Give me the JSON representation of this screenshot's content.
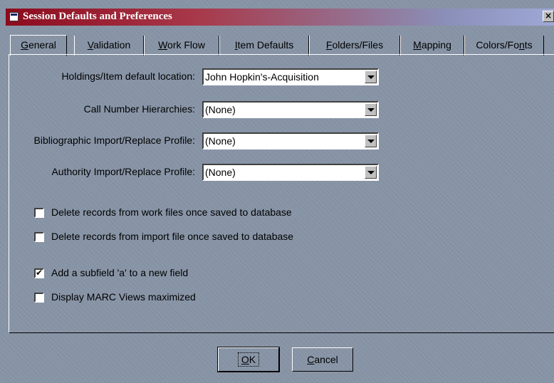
{
  "window": {
    "title": "Session Defaults and Preferences",
    "close_glyph": "×"
  },
  "tabs": [
    {
      "pre": "",
      "key": "G",
      "post": "eneral",
      "active": true
    },
    {
      "pre": "",
      "key": "V",
      "post": "alidation",
      "active": false
    },
    {
      "pre": "",
      "key": "W",
      "post": "ork Flow",
      "active": false
    },
    {
      "pre": "",
      "key": "I",
      "post": "tem Defaults",
      "active": false
    },
    {
      "pre": "",
      "key": "F",
      "post": "olders/Files",
      "active": false
    },
    {
      "pre": "",
      "key": "M",
      "post": "apping",
      "active": false
    },
    {
      "pre": "Colors/Fo",
      "key": "n",
      "post": "ts",
      "active": false
    }
  ],
  "fields": [
    {
      "label": "Holdings/Item default location:",
      "value": "John Hopkin's-Acquisition"
    },
    {
      "label": "Call Number Hierarchies:",
      "value": "(None)"
    },
    {
      "label": "Bibliographic Import/Replace Profile:",
      "value": "(None)"
    },
    {
      "label": "Authority Import/Replace Profile:",
      "value": "(None)"
    }
  ],
  "checkboxes": [
    {
      "label": "Delete records from work files once saved to database",
      "checked": false
    },
    {
      "label": "Delete records from import file once saved to database",
      "checked": false
    },
    {
      "label": "Add a subfield 'a' to a new field",
      "checked": true
    },
    {
      "label": "Display MARC Views maximized",
      "checked": false
    }
  ],
  "buttons": {
    "ok": {
      "key": "O",
      "post": "K"
    },
    "cancel": {
      "key": "C",
      "post": "ancel"
    }
  },
  "colors": {
    "title_start": "#8c0a1c",
    "title_end": "#9ea8d6",
    "dialog_bg": "#8794a6"
  }
}
